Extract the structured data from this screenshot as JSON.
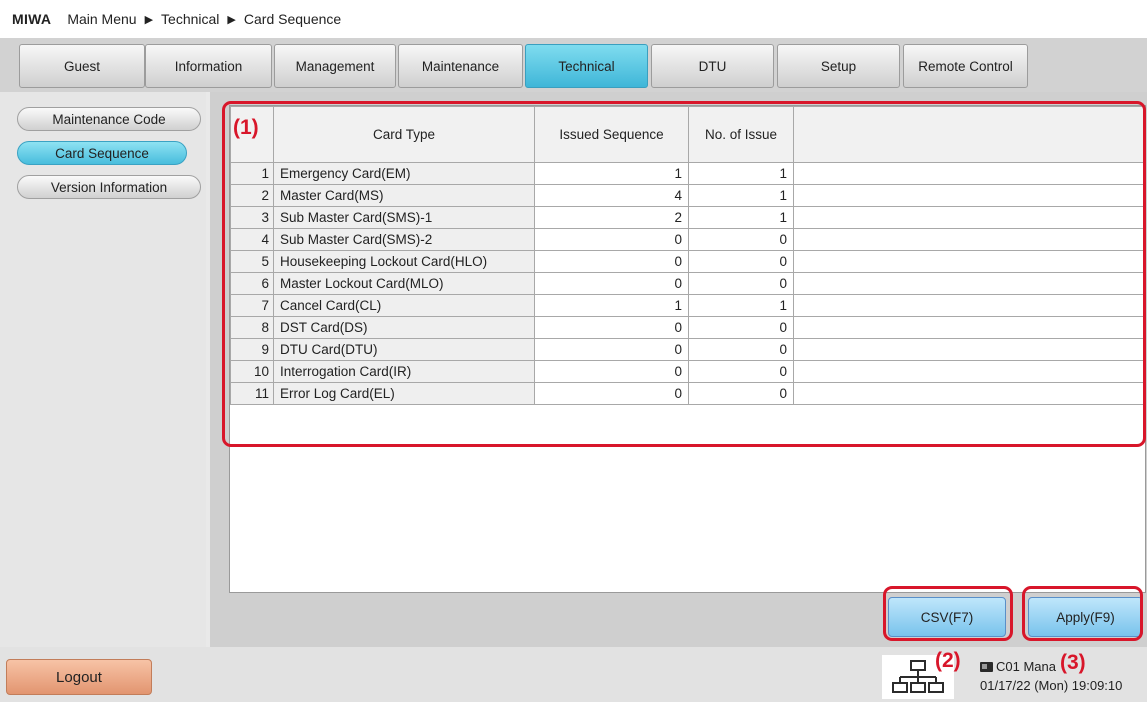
{
  "breadcrumb": {
    "brand": "MIWA",
    "items": [
      "Main Menu",
      "Technical",
      "Card Sequence"
    ]
  },
  "tabs": [
    {
      "label": "Guest"
    },
    {
      "label": "Information"
    },
    {
      "label": "Management"
    },
    {
      "label": "Maintenance"
    },
    {
      "label": "Technical",
      "active": true
    },
    {
      "label": "DTU"
    },
    {
      "label": "Setup"
    },
    {
      "label": "Remote Control"
    }
  ],
  "sidebar": {
    "items": [
      {
        "label": "Maintenance Code"
      },
      {
        "label": "Card Sequence",
        "active": true
      },
      {
        "label": "Version Information"
      }
    ]
  },
  "table": {
    "headers": {
      "no": "",
      "card_type": "Card Type",
      "issued_sequence": "Issued Sequence",
      "no_of_issue": "No. of Issue",
      "extra": ""
    },
    "rows": [
      {
        "no": "1",
        "card_type": "Emergency Card(EM)",
        "issued_sequence": "1",
        "no_of_issue": "1"
      },
      {
        "no": "2",
        "card_type": "Master Card(MS)",
        "issued_sequence": "4",
        "no_of_issue": "1"
      },
      {
        "no": "3",
        "card_type": "Sub Master Card(SMS)-1",
        "issued_sequence": "2",
        "no_of_issue": "1"
      },
      {
        "no": "4",
        "card_type": "Sub Master Card(SMS)-2",
        "issued_sequence": "0",
        "no_of_issue": "0"
      },
      {
        "no": "5",
        "card_type": "Housekeeping Lockout Card(HLO)",
        "issued_sequence": "0",
        "no_of_issue": "0"
      },
      {
        "no": "6",
        "card_type": "Master Lockout Card(MLO)",
        "issued_sequence": "0",
        "no_of_issue": "0"
      },
      {
        "no": "7",
        "card_type": "Cancel Card(CL)",
        "issued_sequence": "1",
        "no_of_issue": "1"
      },
      {
        "no": "8",
        "card_type": "DST Card(DS)",
        "issued_sequence": "0",
        "no_of_issue": "0"
      },
      {
        "no": "9",
        "card_type": "DTU Card(DTU)",
        "issued_sequence": "0",
        "no_of_issue": "0"
      },
      {
        "no": "10",
        "card_type": "Interrogation Card(IR)",
        "issued_sequence": "0",
        "no_of_issue": "0"
      },
      {
        "no": "11",
        "card_type": "Error Log Card(EL)",
        "issued_sequence": "0",
        "no_of_issue": "0"
      }
    ]
  },
  "actions": {
    "csv_label": "CSV(F7)",
    "apply_label": "Apply(F9)"
  },
  "footer": {
    "logout_label": "Logout",
    "terminal": "C01 Mana",
    "datetime": "01/17/22 (Mon) 19:09:10",
    "network_icon": "network-icon",
    "pc_icon": "pc-icon"
  },
  "annotations": {
    "callout_1": "(1)",
    "callout_2": "(2)",
    "callout_3": "(3)",
    "color": "#d8162a"
  }
}
